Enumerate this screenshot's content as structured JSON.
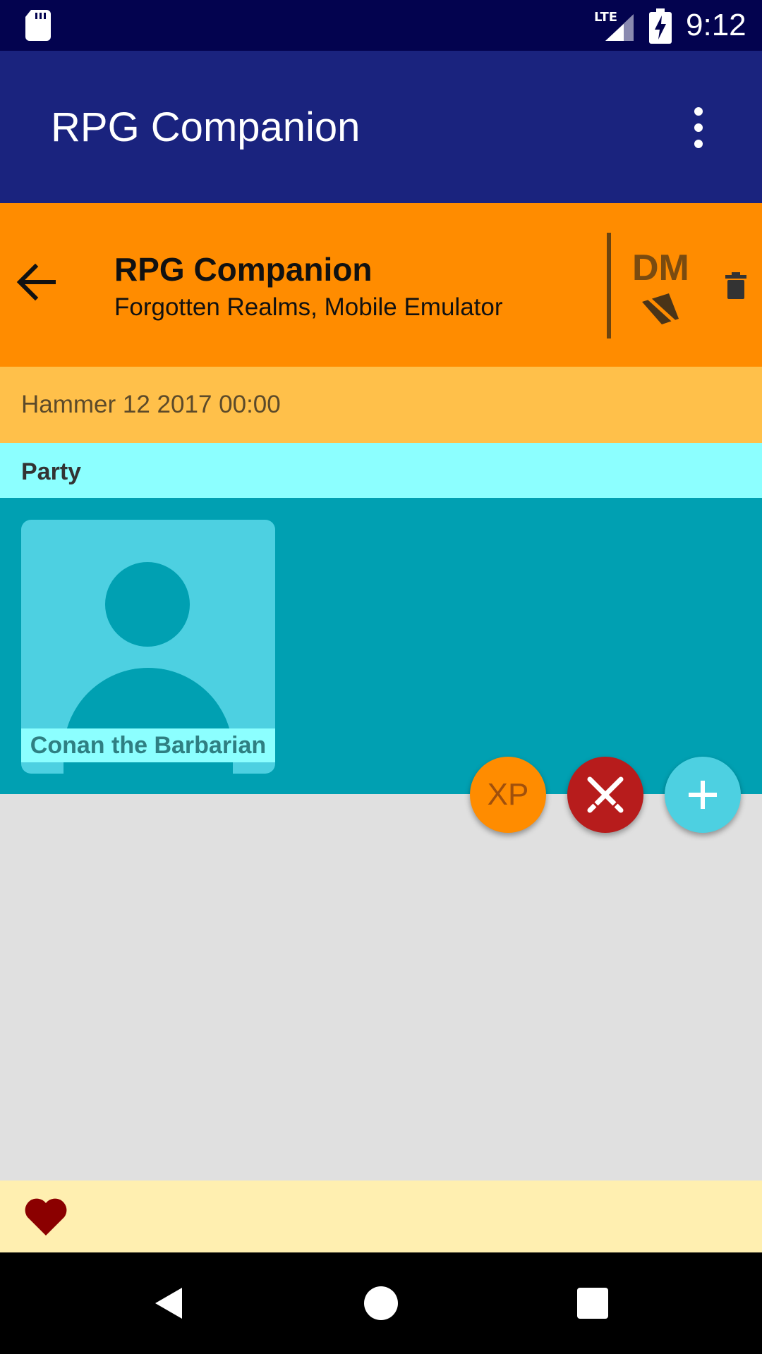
{
  "status_bar": {
    "time": "9:12",
    "network": "LTE",
    "icons": [
      "sd-card-icon",
      "lte-signal-icon",
      "battery-charging-icon"
    ]
  },
  "app_bar": {
    "title": "RPG Companion",
    "overflow_icon": "more-vert-icon"
  },
  "campaign_header": {
    "title": "RPG Companion",
    "subtitle": "Forgotten Realms, Mobile Emulator",
    "role": "DM",
    "icons": [
      "back-arrow-icon",
      "no-signal-icon",
      "delete-icon"
    ]
  },
  "date_bar": {
    "text": "Hammer 12 2017 00:00"
  },
  "party": {
    "label": "Party",
    "characters": [
      {
        "name": "Conan the Barbarian",
        "avatar": "person-placeholder-icon"
      }
    ]
  },
  "fabs": {
    "xp_label": "XP",
    "combat_icon": "crossed-swords-icon",
    "add_icon": "plus-icon"
  },
  "bottom_strip": {
    "icon": "heart-icon"
  },
  "colors": {
    "status_bar": "#03034f",
    "app_bar": "#1a237e",
    "campaign_header": "#ff8c00",
    "date_bar": "#ffc04a",
    "party_header": "#8cffff",
    "party_area": "#00a0b2",
    "combat_fab": "#b71c1c",
    "add_fab": "#4dd0e1",
    "heart": "#8b0000"
  }
}
